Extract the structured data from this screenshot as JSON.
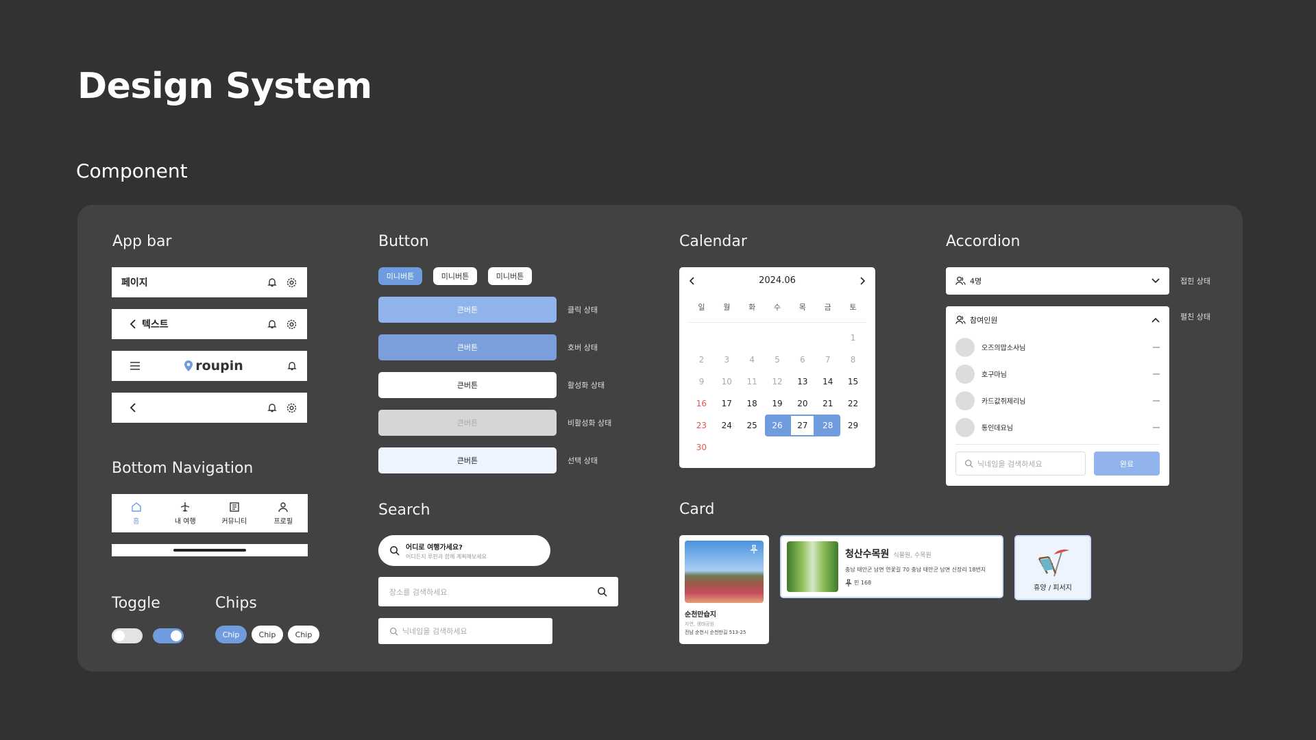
{
  "page": {
    "title": "Design System",
    "subtitle": "Component"
  },
  "sections": {
    "appbar": "App bar",
    "button": "Button",
    "calendar": "Calendar",
    "accordion": "Accordion",
    "bottom_nav": "Bottom Navigation",
    "search": "Search",
    "card": "Card",
    "toggle": "Toggle",
    "chips": "Chips"
  },
  "appbars": {
    "a1_title": "페이지",
    "a2_title": "텍스트",
    "logo": "roupin"
  },
  "buttons": {
    "mini": [
      "미니버튼",
      "미니버튼",
      "미니버튼"
    ],
    "big_label": "큰버튼",
    "states": [
      "클릭 상태",
      "호버 상태",
      "활성화 상태",
      "비활성화 상태",
      "선택 상태"
    ]
  },
  "calendar": {
    "month": "2024.06",
    "weekdays": [
      "일",
      "월",
      "화",
      "수",
      "목",
      "금",
      "토"
    ],
    "weeks": [
      [
        "",
        "",
        "",
        "",
        "",
        "",
        "1"
      ],
      [
        "2",
        "3",
        "4",
        "5",
        "6",
        "7",
        "8"
      ],
      [
        "9",
        "10",
        "11",
        "12",
        "13",
        "14",
        "15"
      ],
      [
        "16",
        "17",
        "18",
        "19",
        "20",
        "21",
        "22"
      ],
      [
        "23",
        "24",
        "25",
        "26",
        "27",
        "28",
        "29"
      ],
      [
        "30",
        "",
        "",
        "",
        "",
        "",
        ""
      ]
    ],
    "range_start": "26",
    "range_end": "28",
    "accent": "#6f9bdf",
    "holiday": "#e55353"
  },
  "accordion": {
    "closed_label": "4명",
    "closed_state": "접힌 상태",
    "open_label": "참여인원",
    "open_state": "펼친 상태",
    "members": [
      "오즈의맙소사님",
      "호구마님",
      "카드값쥐제리님",
      "통인데요님"
    ],
    "search_placeholder": "닉네임을 검색하세요",
    "done_label": "완료"
  },
  "bottom_nav": {
    "items": [
      "홈",
      "내 여행",
      "커뮤니티",
      "프로필"
    ]
  },
  "search": {
    "hero_title": "어디로 여행가세요?",
    "hero_sub": "어디든지 루핀과 함께 계획해보세요",
    "place_placeholder": "장소를 검색하세요",
    "nick_placeholder": "닉네임을 검색하세요"
  },
  "cards": {
    "c1_title": "순천만습지",
    "c1_sub": "자연, 생태공원",
    "c1_addr": "전남 순천시 순천만길 513-25",
    "c2_title": "청산수목원",
    "c2_tag": "식물원, 수목원",
    "c2_addr": "충남 태안군 남면 연꽃길 70 충남 태안군 남면 신장리 18번지",
    "c2_pins": "핀 168",
    "c3_label": "휴양 / 피서지"
  },
  "chips": {
    "items": [
      "Chip",
      "Chip",
      "Chip"
    ]
  },
  "colors": {
    "background": "#323232",
    "panel": "#424242",
    "accent": "#6f9bdf",
    "light_accent": "#eef4fd"
  }
}
